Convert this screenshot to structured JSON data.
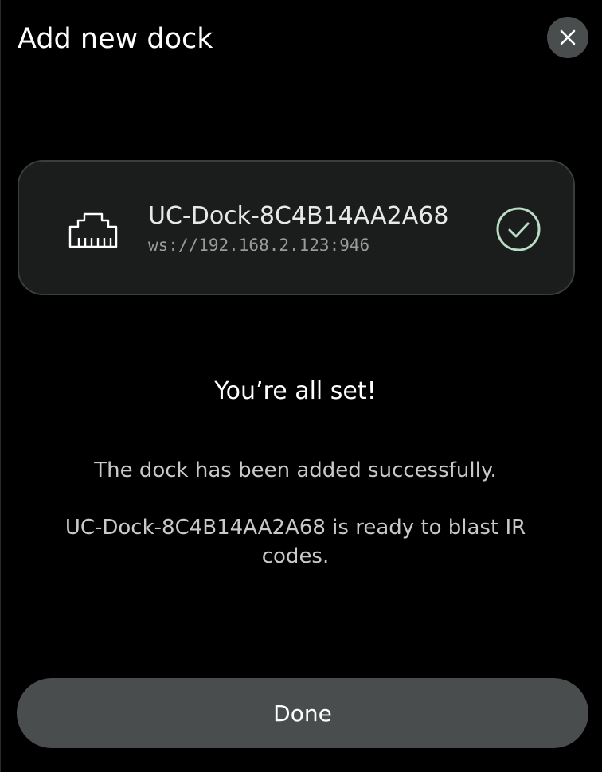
{
  "header": {
    "title": "Add new dock",
    "close_icon": "close-icon"
  },
  "dock": {
    "icon": "ethernet-port-icon",
    "name": "UC-Dock-8C4B14AA2A68",
    "address": "ws://192.168.2.123:946",
    "status_icon": "check-circle-icon"
  },
  "status": {
    "title": "You’re all set!",
    "message": "The dock has been added successfully.",
    "detail": "UC-Dock-8C4B14AA2A68 is ready to blast IR codes."
  },
  "actions": {
    "done_label": "Done"
  },
  "colors": {
    "background": "#000000",
    "card_background": "#1b1c1c",
    "card_border": "#3a3d3d",
    "button_background": "#4a4d4d",
    "check_color": "#b8dcc4",
    "muted_text": "#c9c9c9"
  }
}
